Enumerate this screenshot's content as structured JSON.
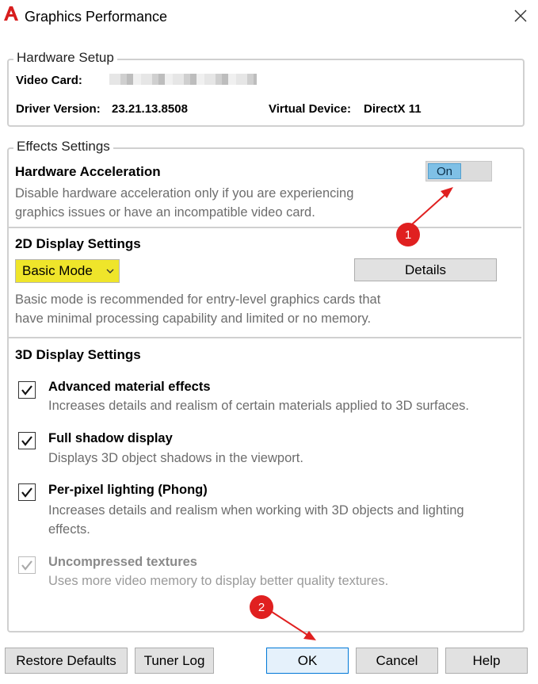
{
  "window": {
    "title": "Graphics Performance",
    "app_icon": "autocad-logo-icon",
    "close_icon": "close-icon"
  },
  "hardware_setup": {
    "legend": "Hardware Setup",
    "video_card_label": "Video Card:",
    "driver_version_label": "Driver Version:",
    "driver_version_value": "23.21.13.8508",
    "virtual_device_label": "Virtual Device:",
    "virtual_device_value": "DirectX 11"
  },
  "effects_settings": {
    "legend": "Effects Settings",
    "hardware_acceleration": {
      "title": "Hardware Acceleration",
      "desc_line1": "Disable hardware acceleration only if you are experiencing",
      "desc_line2": "graphics issues or have an incompatible video card.",
      "toggle_label": "On"
    },
    "display_2d": {
      "title": "2D Display Settings",
      "mode_selected": "Basic Mode",
      "details_button": "Details",
      "desc_line1": "Basic mode is recommended for entry-level graphics cards that",
      "desc_line2": "have minimal processing capability and limited or no memory."
    },
    "display_3d": {
      "title": "3D Display Settings",
      "options": [
        {
          "title": "Advanced material effects",
          "desc1": "Increases details and realism of certain materials applied to 3D surfaces.",
          "desc2": "",
          "checked": true,
          "enabled": true
        },
        {
          "title": "Full shadow display",
          "desc1": "Displays 3D object shadows in the viewport.",
          "desc2": "",
          "checked": true,
          "enabled": true
        },
        {
          "title": "Per-pixel lighting (Phong)",
          "desc1": "Increases details and realism when working with 3D objects and lighting",
          "desc2": "effects.",
          "checked": true,
          "enabled": true
        },
        {
          "title": "Uncompressed textures",
          "desc1": "Uses more video memory to display better quality textures.",
          "desc2": "",
          "checked": true,
          "enabled": false
        }
      ]
    }
  },
  "footer": {
    "restore_defaults": "Restore Defaults",
    "tuner_log": "Tuner Log",
    "ok": "OK",
    "cancel": "Cancel",
    "help": "Help"
  },
  "annotations": {
    "badge1": "1",
    "badge2": "2",
    "color": "#e02020",
    "highlight_color": "#efe52a"
  }
}
